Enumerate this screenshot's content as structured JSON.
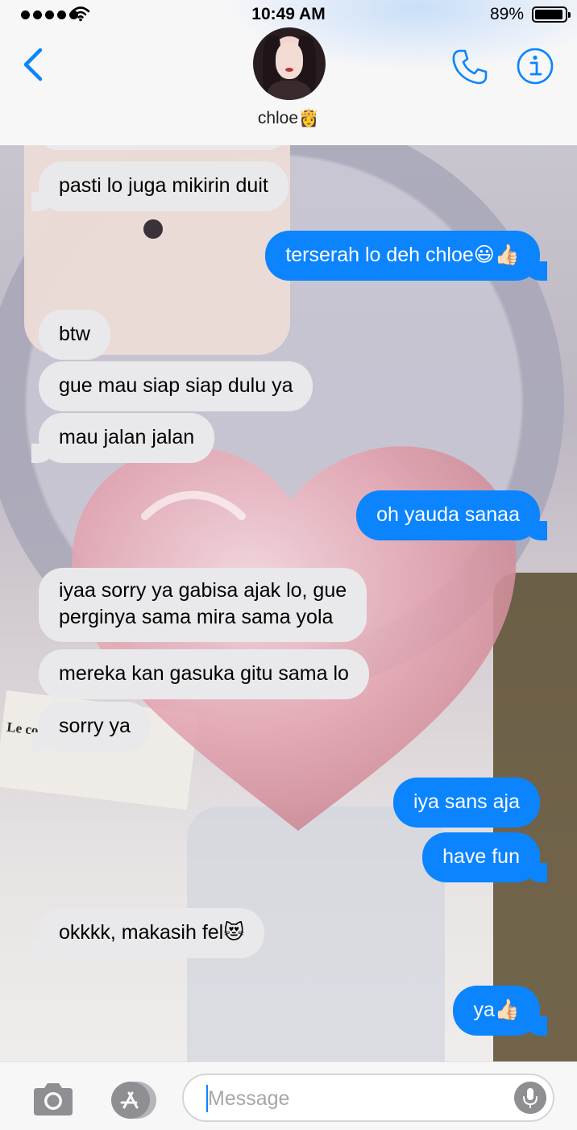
{
  "status_bar": {
    "time": "10:49 AM",
    "battery": "89%"
  },
  "header": {
    "contact_name": "chloe👸"
  },
  "messages": [
    {
      "text": "pasti lo juga mikirin duit",
      "from": "them"
    },
    {
      "text": "terserah lo deh chloe😃👍🏻",
      "from": "me"
    },
    {
      "text": "btw",
      "from": "them"
    },
    {
      "text": "gue mau siap siap dulu ya",
      "from": "them"
    },
    {
      "text": "mau jalan jalan",
      "from": "them"
    },
    {
      "text": "oh yauda sanaa",
      "from": "me"
    },
    {
      "text": "iyaa sorry ya gabisa ajak lo, gue",
      "text2": "perginya sama mira sama yola",
      "from": "them"
    },
    {
      "text": "mereka kan gasuka gitu sama lo",
      "from": "them"
    },
    {
      "text": "sorry ya",
      "from": "them"
    },
    {
      "text": "iya sans aja",
      "from": "me"
    },
    {
      "text": "have fun",
      "from": "me"
    },
    {
      "text": "okkkk, makasih fel😻",
      "from": "them"
    },
    {
      "text": "ya👍🏻",
      "from": "me"
    }
  ],
  "background": {
    "book_text": "Le comte de Monte"
  },
  "input": {
    "placeholder": "Message"
  },
  "colors": {
    "accent": "#0b84fe",
    "incoming_bubble": "#e9e9eb",
    "header_bg": "#f7f7f8"
  },
  "icons": [
    "back-chevron-icon",
    "phone-icon",
    "info-icon",
    "camera-icon",
    "app-store-icon",
    "microphone-icon",
    "wifi-icon"
  ]
}
